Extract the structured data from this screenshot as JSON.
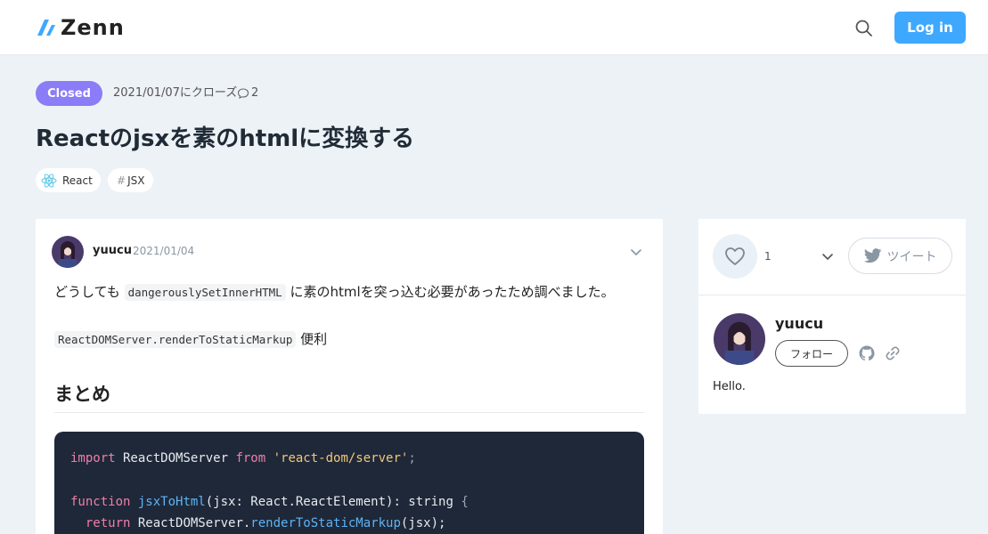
{
  "header": {
    "logo_text": "Zenn",
    "login_label": "Log in",
    "brand_color": "#3ea8ff"
  },
  "scrap": {
    "status": "Closed",
    "status_color": "#8b7cf7",
    "closed_text": "2021/01/07にクローズ",
    "comment_count": "2",
    "title": "Reactのjsxを素のhtmlに変換する",
    "topics": [
      {
        "icon": "react-icon",
        "label": "React"
      },
      {
        "icon": "hash",
        "label": "JSX"
      }
    ]
  },
  "post": {
    "author": "yuucu",
    "date": "2021/01/04",
    "line1_before": "どうしても ",
    "line1_code": "dangerouslySetInnerHTML",
    "line1_after": " に素のhtmlを突っ込む必要があったため調べました。",
    "line2_code": "ReactDOMServer.renderToStaticMarkup",
    "line2_after": " 便利",
    "heading": "まとめ",
    "code": {
      "l1_kw": "import",
      "l1_name": " ReactDOMServer ",
      "l1_from": "from",
      "l1_str": " 'react-dom/server'",
      "l1_end": ";",
      "l2_kw": "function",
      "l2_fn": " jsxToHtml",
      "l2_args": "(jsx: React.ReactElement)",
      "l2_ret": ": string ",
      "l2_brace": "{",
      "l3_kw": "  return",
      "l3_obj": " ReactDOMServer.",
      "l3_fn": "renderToStaticMarkup",
      "l3_args": "(jsx);"
    }
  },
  "sidebar": {
    "like_count": "1",
    "tweet_label": "ツイート",
    "author": "yuucu",
    "follow_label": "フォロー",
    "bio": "Hello."
  }
}
